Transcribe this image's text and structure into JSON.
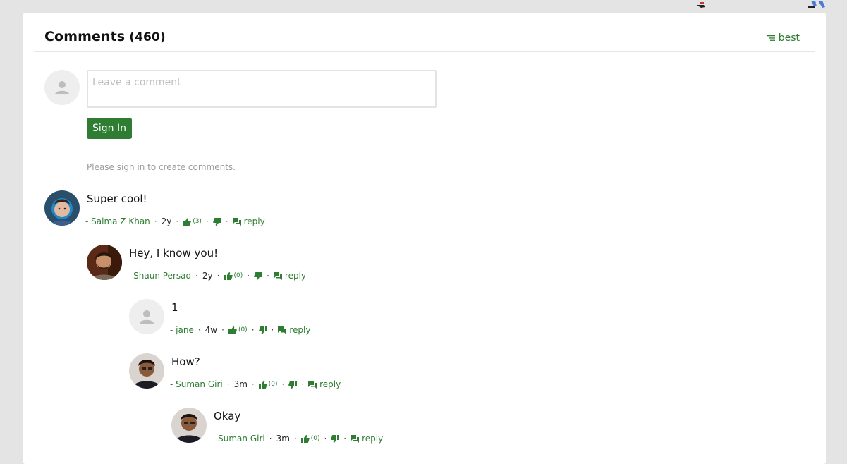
{
  "header": {
    "title": "Comments",
    "count": "(460)",
    "sort_label": "best"
  },
  "composer": {
    "placeholder": "Leave a comment",
    "signin_label": "Sign In",
    "note": "Please sign in to create comments."
  },
  "icons": {
    "sort": "sort-lines-icon",
    "default_avatar": "person-icon",
    "upvote": "thumbs-up-icon",
    "downvote": "thumbs-down-icon",
    "reply": "speech-bubbles-icon"
  },
  "colors": {
    "accent": "#2e7d32",
    "background": "#e4e4e4",
    "card": "#ffffff"
  },
  "comments": [
    {
      "text": "Super cool!",
      "author": "- Saima Z Khan",
      "age": "2y",
      "upvotes": "(3)",
      "reply_label": "reply"
    },
    {
      "text": "Hey, I know you!",
      "author": "- Shaun Persad",
      "age": "2y",
      "upvotes": "(0)",
      "reply_label": "reply"
    },
    {
      "text": "1",
      "author": "- jane",
      "age": "4w",
      "upvotes": "(0)",
      "reply_label": "reply"
    },
    {
      "text": "How?",
      "author": "- Suman Giri",
      "age": "3m",
      "upvotes": "(0)",
      "reply_label": "reply"
    },
    {
      "text": "Okay",
      "author": "- Suman Giri",
      "age": "3m",
      "upvotes": "(0)",
      "reply_label": "reply"
    }
  ]
}
